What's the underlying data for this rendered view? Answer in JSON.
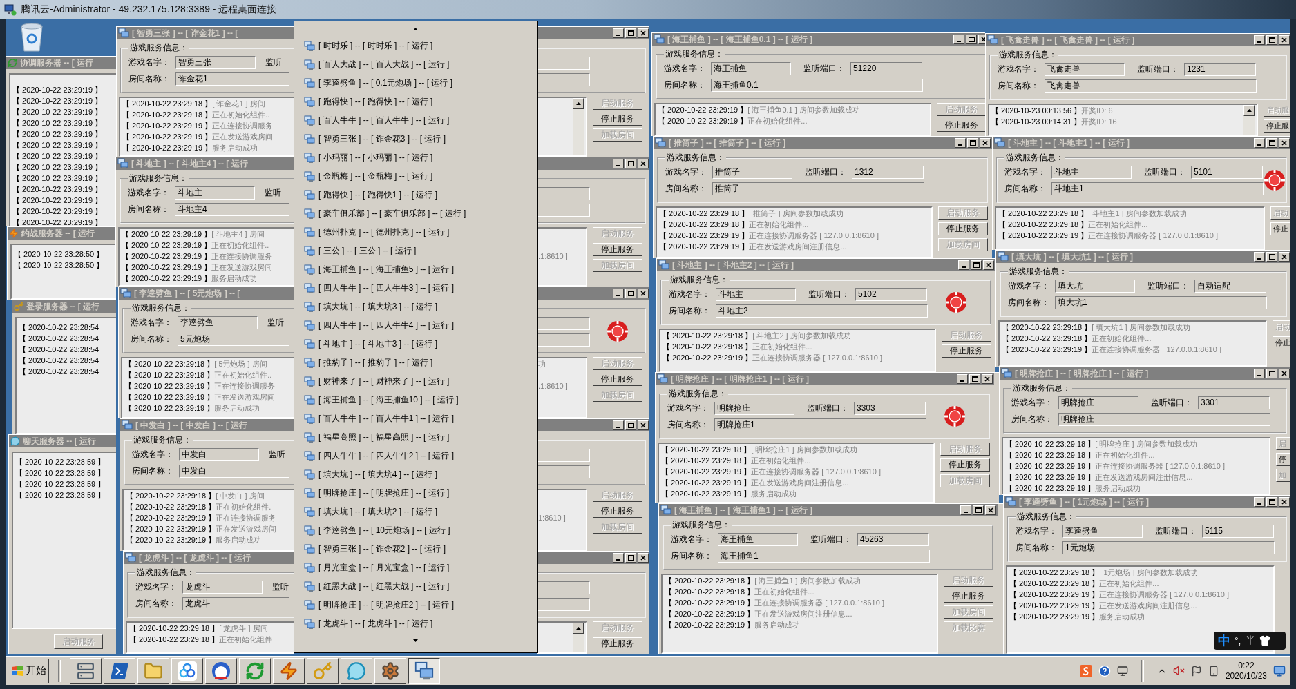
{
  "rdp_title": "腾讯云-Administrator - 49.232.175.128:3389 - 远程桌面连接",
  "service_windows": [
    {
      "title": "协调服务器 -- [ 运行",
      "logs": [
        "【 2020-10-22 23:29:19 】",
        "【 2020-10-22 23:29:19 】",
        "【 2020-10-22 23:29:19 】",
        "【 2020-10-22 23:29:19 】",
        "【 2020-10-22 23:29:19 】",
        "【 2020-10-22 23:29:19 】",
        "【 2020-10-22 23:29:19 】",
        "【 2020-10-22 23:29:19 】",
        "【 2020-10-22 23:29:19 】",
        "【 2020-10-22 23:29:19 】",
        "【 2020-10-22 23:29:19 】",
        "【 2020-10-22 23:29:19 】",
        "【 2020-10-22 23:29:19 】"
      ]
    },
    {
      "title": "约战服务器 -- [ 运行",
      "logs": [
        "【 2020-10-22 23:28:50 】",
        "【 2020-10-22 23:28:50 】"
      ]
    },
    {
      "title": "登录服务器 -- [ 运行",
      "logs": [
        "【 2020-10-22 23:28:54",
        "【 2020-10-22 23:28:54",
        "【 2020-10-22 23:28:54",
        "【 2020-10-22 23:28:54",
        "【 2020-10-22 23:28:54"
      ]
    },
    {
      "title": "聊天服务器 -- [ 运行",
      "logs": [
        "【 2020-10-22 23:28:59 】",
        "【 2020-10-22 23:28:59 】",
        "【 2020-10-22 23:28:59 】",
        "【 2020-10-22 23:28:59 】"
      ],
      "buttons": [
        {
          "label": "启动服务",
          "disabled": true
        }
      ]
    }
  ],
  "game_windows": [
    {
      "title": "[ 智勇三张 ] -- [ 诈金花1 ] -- [",
      "group_label": "游戏服务信息：",
      "name_label": "游戏名字：",
      "name": "智勇三张",
      "port_label": "监听",
      "room_label": "房间名称：",
      "room": "诈金花1",
      "logs": [
        {
          "time": "【 2020-10-22 23:29:18 】",
          "text": "[ 诈金花1 ] 房间"
        },
        {
          "time": "【 2020-10-22 23:29:18 】",
          "text": "正在初始化组件.."
        },
        {
          "time": "【 2020-10-22 23:29:19 】",
          "text": "正在连接协调服务"
        },
        {
          "time": "【 2020-10-22 23:29:19 】",
          "text": "正在发送游戏房间"
        },
        {
          "time": "【 2020-10-22 23:29:19 】",
          "text": "服务启动成功"
        }
      ],
      "buttons": [
        {
          "label": "启动服务",
          "disabled": true
        },
        {
          "label": "停止服务",
          "disabled": false
        },
        {
          "label": "加载房间",
          "disabled": true
        }
      ]
    },
    {
      "title": "[ 斗地主 ] -- [ 斗地主4 ] -- [ 运行",
      "group_label": "游戏服务信息：",
      "name_label": "游戏名字：",
      "name": "斗地主",
      "port_label": "监听",
      "room_label": "房间名称：",
      "room": "斗地主4",
      "logs": [
        {
          "time": "【 2020-10-22 23:29:19 】",
          "text": "[ 斗地主4 ] 房间"
        },
        {
          "time": "【 2020-10-22 23:29:19 】",
          "text": "正在初始化组件.."
        },
        {
          "time": "【 2020-10-22 23:29:19 】",
          "text": "正在连接协调服务",
          "tail": ".1:8610 ]"
        },
        {
          "time": "【 2020-10-22 23:29:19 】",
          "text": "正在发送游戏房间"
        },
        {
          "time": "【 2020-10-22 23:29:19 】",
          "text": "服务启动成功"
        }
      ],
      "buttons": [
        {
          "label": "启动服务",
          "disabled": true
        },
        {
          "label": "停止服务",
          "disabled": false
        },
        {
          "label": "加载房间",
          "disabled": true
        }
      ]
    },
    {
      "title": "[ 李逵劈鱼 ] -- [ 5元炮场 ] -- [",
      "group_label": "游戏服务信息：",
      "name_label": "游戏名字：",
      "name": "李逵劈鱼",
      "port_label": "监听",
      "room_label": "房间名称：",
      "room": "5元炮场",
      "chip": true,
      "logs": [
        {
          "time": "【 2020-10-22 23:29:18 】",
          "text": "[ 5元炮场 ] 房间",
          "tail": "功"
        },
        {
          "time": "【 2020-10-22 23:29:18 】",
          "text": "正在初始化组件.."
        },
        {
          "time": "【 2020-10-22 23:29:19 】",
          "text": "正在连接协调服务",
          "tail": ".1:8610 ]"
        },
        {
          "time": "【 2020-10-22 23:29:19 】",
          "text": "正在发送游戏房间"
        },
        {
          "time": "【 2020-10-22 23:29:19 】",
          "text": "服务启动成功"
        }
      ],
      "buttons": [
        {
          "label": "启动服务",
          "disabled": true
        },
        {
          "label": "停止服务",
          "disabled": false
        },
        {
          "label": "加载房间",
          "disabled": true
        }
      ]
    },
    {
      "title": "[ 中发白 ] -- [ 中发白 ] -- [ 运行",
      "group_label": "游戏服务信息：",
      "name_label": "游戏名字：",
      "name": "中发白",
      "port_label": "监听",
      "room_label": "房间名称：",
      "room": "中发白",
      "logs": [
        {
          "time": "【 2020-10-22 23:29:18 】",
          "text": "[ 中发白 ] 房间"
        },
        {
          "time": "【 2020-10-22 23:29:18 】",
          "text": "正在初始化组件."
        },
        {
          "time": "【 2020-10-22 23:29:19 】",
          "text": "正在连接协调服务",
          "tail": "1:8610 ]"
        },
        {
          "time": "【 2020-10-22 23:29:19 】",
          "text": "正在发送游戏房间"
        },
        {
          "time": "【 2020-10-22 23:29:19 】",
          "text": "服务启动成功"
        }
      ],
      "buttons": [
        {
          "label": "启动服务",
          "disabled": true
        },
        {
          "label": "停止服务",
          "disabled": false
        },
        {
          "label": "加载房间",
          "disabled": true
        }
      ]
    },
    {
      "title": "[ 龙虎斗 ] -- [ 龙虎斗 ] -- [ 运行",
      "group_label": "游戏服务信息：",
      "name_label": "游戏名字：",
      "name": "龙虎斗",
      "port_label": "监听",
      "room_label": "房间名称：",
      "room": "龙虎斗",
      "logs": [
        {
          "time": "【 2020-10-22 23:29:18 】",
          "text": "[ 龙虎斗 ] 房间"
        },
        {
          "time": "【 2020-10-22 23:29:18 】",
          "text": "正在初始化组件"
        }
      ],
      "buttons": [
        {
          "label": "启动服务",
          "disabled": true
        },
        {
          "label": "停止服务",
          "disabled": false
        }
      ]
    },
    {
      "title": "[ 海王捕鱼 ] -- [ 海王捕鱼0.1 ] -- [ 运行 ]",
      "group_label": "游戏服务信息：",
      "name_label": "游戏名字：",
      "name": "海王捕鱼",
      "port_label": "监听端口：",
      "port": "51220",
      "room_label": "房间名称：",
      "room": "海王捕鱼0.1",
      "logs": [
        {
          "time": "【 2020-10-22 23:29:19 】",
          "text": "[ 海王捕鱼0.1 ] 房间参数加载成功"
        },
        {
          "time": "【 2020-10-22 23:29:19 】",
          "text": "正在初始化组件..."
        }
      ],
      "buttons": [
        {
          "label": "启动服务",
          "disabled": true
        },
        {
          "label": "停止服务",
          "disabled": false
        }
      ]
    },
    {
      "title": "[ 推筒子 ] -- [ 推筒子 ] -- [ 运行 ]",
      "group_label": "游戏服务信息：",
      "name_label": "游戏名字：",
      "name": "推筒子",
      "port_label": "监听端口：",
      "port": "1312",
      "room_label": "房间名称：",
      "room": "推筒子",
      "logs": [
        {
          "time": "【 2020-10-22 23:29:18 】",
          "text": "[ 推筒子 ] 房间参数加载成功"
        },
        {
          "time": "【 2020-10-22 23:29:18 】",
          "text": "正在初始化组件..."
        },
        {
          "time": "【 2020-10-22 23:29:19 】",
          "text": "正在连接协调服务器 [ 127.0.0.1:8610 ]"
        },
        {
          "time": "【 2020-10-22 23:29:19 】",
          "text": "正在发送游戏房间注册信息..."
        }
      ],
      "buttons": [
        {
          "label": "启动服务",
          "disabled": true
        },
        {
          "label": "停止服务",
          "disabled": false
        },
        {
          "label": "加载房间",
          "disabled": true
        }
      ]
    },
    {
      "title": "[ 斗地主 ] -- [ 斗地主2 ] -- [ 运行 ]",
      "group_label": "游戏服务信息：",
      "name_label": "游戏名字：",
      "name": "斗地主",
      "port_label": "监听端口：",
      "port": "5102",
      "room_label": "房间名称：",
      "room": "斗地主2",
      "chip": true,
      "logs": [
        {
          "time": "【 2020-10-22 23:29:18 】",
          "text": "[ 斗地主2 ] 房间参数加载成功"
        },
        {
          "time": "【 2020-10-22 23:29:18 】",
          "text": "正在初始化组件..."
        },
        {
          "time": "【 2020-10-22 23:29:19 】",
          "text": "正在连接协调服务器 [ 127.0.0.1:8610 ]"
        }
      ],
      "buttons": [
        {
          "label": "启动服务",
          "disabled": true
        },
        {
          "label": "停止服务",
          "disabled": false
        }
      ]
    },
    {
      "title": "[ 明牌抢庄 ] -- [ 明牌抢庄1 ] -- [ 运行 ]",
      "group_label": "游戏服务信息：",
      "name_label": "游戏名字：",
      "name": "明牌抢庄",
      "port_label": "监听端口：",
      "port": "3303",
      "room_label": "房间名称：",
      "room": "明牌抢庄1",
      "chip": true,
      "logs": [
        {
          "time": "【 2020-10-22 23:29:18 】",
          "text": "[ 明牌抢庄1 ] 房间参数加载成功"
        },
        {
          "time": "【 2020-10-22 23:29:18 】",
          "text": "正在初始化组件..."
        },
        {
          "time": "【 2020-10-22 23:29:19 】",
          "text": "正在连接协调服务器 [ 127.0.0.1:8610 ]"
        },
        {
          "time": "【 2020-10-22 23:29:19 】",
          "text": "正在发送游戏房间注册信息..."
        },
        {
          "time": "【 2020-10-22 23:29:19 】",
          "text": "服务启动成功"
        }
      ],
      "buttons": [
        {
          "label": "启动服务",
          "disabled": true
        },
        {
          "label": "停止服务",
          "disabled": false
        },
        {
          "label": "加载房间",
          "disabled": true
        }
      ]
    },
    {
      "title": "[ 海王捕鱼 ] -- [ 海王捕鱼1 ] -- [ 运行 ]",
      "group_label": "游戏服务信息：",
      "name_label": "游戏名字：",
      "name": "海王捕鱼",
      "port_label": "监听端口：",
      "port": "45263",
      "room_label": "房间名称：",
      "room": "海王捕鱼1",
      "logs": [
        {
          "time": "【 2020-10-22 23:29:18 】",
          "text": "[ 海王捕鱼1 ] 房间参数加载成功"
        },
        {
          "time": "【 2020-10-22 23:29:18 】",
          "text": "正在初始化组件..."
        },
        {
          "time": "【 2020-10-22 23:29:19 】",
          "text": "正在连接协调服务器 [ 127.0.0.1:8610 ]"
        },
        {
          "time": "【 2020-10-22 23:29:19 】",
          "text": "正在发送游戏房间注册信息..."
        },
        {
          "time": "【 2020-10-22 23:29:19 】",
          "text": "服务启动成功"
        }
      ],
      "buttons": [
        {
          "label": "启动服务",
          "disabled": true
        },
        {
          "label": "停止服务",
          "disabled": false
        },
        {
          "label": "加载房间",
          "disabled": true
        },
        {
          "label": "加载比赛",
          "disabled": true
        }
      ]
    },
    {
      "title": "[ 飞禽走兽 ] -- [ 飞禽走兽 ] -- [ 运行 ]",
      "group_label": "游戏服务信息：",
      "name_label": "游戏名字：",
      "name": "飞禽走兽",
      "port_label": "监听端口：",
      "port": "1231",
      "room_label": "房间名称：",
      "room": "飞禽走兽",
      "logs": [
        {
          "time": "【 2020-10-23 00:13:56 】",
          "text": "开奖ID: 6"
        },
        {
          "time": "【 2020-10-23 00:14:31 】",
          "text": "开奖ID: 16"
        }
      ],
      "buttons": [
        {
          "label": "启动服",
          "disabled": true
        },
        {
          "label": "停止服",
          "disabled": false
        }
      ]
    },
    {
      "title": "[ 斗地主 ] -- [ 斗地主1 ] -- [ 运行 ]",
      "group_label": "游戏服务信息：",
      "name_label": "游戏名字：",
      "name": "斗地主",
      "port_label": "监听端口：",
      "port": "5101",
      "room_label": "房间名称：",
      "room": "斗地主1",
      "chip": true,
      "logs": [
        {
          "time": "【 2020-10-22 23:29:18 】",
          "text": "[ 斗地主1 ] 房间参数加载成功"
        },
        {
          "time": "【 2020-10-22 23:29:18 】",
          "text": "正在初始化组件..."
        },
        {
          "time": "【 2020-10-22 23:29:19 】",
          "text": "正在连接协调服务器 [ 127.0.0.1:8610 ]"
        }
      ],
      "buttons": [
        {
          "label": "启动",
          "disabled": true
        },
        {
          "label": "停止",
          "disabled": false
        }
      ]
    },
    {
      "title": "[ 填大坑 ] -- [ 填大坑1 ] -- [ 运行 ]",
      "group_label": "游戏服务信息：",
      "name_label": "游戏名字：",
      "name": "填大坑",
      "port_label": "监听端口：",
      "port": "自动适配",
      "room_label": "房间名称：",
      "room": "填大坑1",
      "logs": [
        {
          "time": "【 2020-10-22 23:29:18 】",
          "text": "[ 填大坑1 ] 房间参数加载成功"
        },
        {
          "time": "【 2020-10-22 23:29:18 】",
          "text": "正在初始化组件..."
        },
        {
          "time": "【 2020-10-22 23:29:19 】",
          "text": "正在连接协调服务器 [ 127.0.0.1:8610 ]"
        }
      ],
      "buttons": [
        {
          "label": "启动",
          "disabled": true
        },
        {
          "label": "停止",
          "disabled": false
        }
      ]
    },
    {
      "title": "[ 明牌抢庄 ] -- [ 明牌抢庄 ] -- [ 运行 ]",
      "group_label": "游戏服务信息：",
      "name_label": "游戏名字：",
      "name": "明牌抢庄",
      "port_label": "监听端口：",
      "port": "3301",
      "room_label": "房间名称：",
      "room": "明牌抢庄",
      "logs": [
        {
          "time": "【 2020-10-22 23:29:18 】",
          "text": "[ 明牌抢庄 ] 房间参数加载成功"
        },
        {
          "time": "【 2020-10-22 23:29:18 】",
          "text": "正在初始化组件..."
        },
        {
          "time": "【 2020-10-22 23:29:19 】",
          "text": "正在连接协调服务器 [ 127.0.0.1:8610 ]"
        },
        {
          "time": "【 2020-10-22 23:29:19 】",
          "text": "正在发送游戏房间注册信息..."
        },
        {
          "time": "【 2020-10-22 23:29:19 】",
          "text": "服务启动成功"
        }
      ],
      "buttons": [
        {
          "label": "启",
          "disabled": true
        },
        {
          "label": "停",
          "disabled": false
        },
        {
          "label": "加",
          "disabled": true
        }
      ]
    },
    {
      "title": "[ 李逵劈鱼 ] -- [ 1元炮场 ] -- [ 运行 ]",
      "group_label": "游戏服务信息：",
      "name_label": "游戏名字：",
      "name": "李逵劈鱼",
      "port_label": "监听端口：",
      "port": "5115",
      "room_label": "房间名称：",
      "room": "1元炮场",
      "logs": [
        {
          "time": "【 2020-10-22 23:29:18 】",
          "text": "[ 1元炮场 ] 房间参数加载成功"
        },
        {
          "time": "【 2020-10-22 23:29:18 】",
          "text": "正在初始化组件..."
        },
        {
          "time": "【 2020-10-22 23:29:19 】",
          "text": "正在连接协调服务器 [ 127.0.0.1:8610 ]"
        },
        {
          "time": "【 2020-10-22 23:29:19 】",
          "text": "正在发送游戏房间注册信息..."
        },
        {
          "time": "【 2020-10-22 23:29:19 】",
          "text": "服务启动成功"
        }
      ]
    }
  ],
  "window_menu": [
    "[ 时时乐 ] -- [ 时时乐 ] -- [ 运行 ]",
    "[ 百人大战 ] -- [ 百人大战 ] -- [ 运行 ]",
    "[ 李逵劈鱼 ] -- [ 0.1元炮场 ] -- [ 运行 ]",
    "[ 跑得快 ] -- [ 跑得快 ] -- [ 运行 ]",
    "[ 百人牛牛 ] -- [ 百人牛牛 ] -- [ 运行 ]",
    "[ 智勇三张 ] -- [ 诈金花3 ] -- [ 运行 ]",
    "[ 小玛丽 ] -- [ 小玛丽 ] -- [ 运行 ]",
    "[ 金瓶梅 ] -- [ 金瓶梅 ] -- [ 运行 ]",
    "[ 跑得快 ] -- [ 跑得快1 ] -- [ 运行 ]",
    "[ 豪车俱乐部 ] -- [ 豪车俱乐部 ] -- [ 运行 ]",
    "[ 德州扑克 ] -- [ 德州扑克 ] -- [ 运行 ]",
    "[ 三公 ] -- [ 三公 ] -- [ 运行 ]",
    "[ 海王捕鱼 ] -- [ 海王捕鱼5 ] -- [ 运行 ]",
    "[ 四人牛牛 ] -- [ 四人牛牛3 ] -- [ 运行 ]",
    "[ 填大坑 ] -- [ 填大坑3 ] -- [ 运行 ]",
    "[ 四人牛牛 ] -- [ 四人牛牛4 ] -- [ 运行 ]",
    "[ 斗地主 ] -- [ 斗地主3 ] -- [ 运行 ]",
    "[ 推豹子 ] -- [ 推豹子 ] -- [ 运行 ]",
    "[ 财神来了 ] -- [ 财神来了 ] -- [ 运行 ]",
    "[ 海王捕鱼 ] -- [ 海王捕鱼10 ] -- [ 运行 ]",
    "[ 百人牛牛 ] -- [ 百人牛牛1 ] -- [ 运行 ]",
    "[ 福星高照 ] -- [ 福星高照 ] -- [ 运行 ]",
    "[ 四人牛牛 ] -- [ 四人牛牛2 ] -- [ 运行 ]",
    "[ 填大坑 ] -- [ 填大坑4 ] -- [ 运行 ]",
    "[ 明牌抢庄 ] -- [ 明牌抢庄 ] -- [ 运行 ]",
    "[ 填大坑 ] -- [ 填大坑2 ] -- [ 运行 ]",
    "[ 李逵劈鱼 ] -- [ 10元炮场 ] -- [ 运行 ]",
    "[ 智勇三张 ] -- [ 诈金花2 ] -- [ 运行 ]",
    "[ 月光宝盒 ] -- [ 月光宝盒 ] -- [ 运行 ]",
    "[ 红黑大战 ] -- [ 红黑大战 ] -- [ 运行 ]",
    "[ 明牌抢庄 ] -- [ 明牌抢庄2 ] -- [ 运行 ]",
    "[ 龙虎斗 ] -- [ 龙虎斗 ] -- [ 运行 ]"
  ],
  "ime": {
    "mode": "中",
    "punct": "°,",
    "width": "半"
  },
  "taskbar": {
    "start": "开始",
    "buttons": [
      {
        "selected": false
      },
      {
        "selected": false
      },
      {
        "selected": false
      },
      {
        "selected": false
      },
      {
        "selected": false
      },
      {
        "selected": false
      },
      {
        "selected": false
      },
      {
        "selected": false
      },
      {
        "selected": false
      },
      {
        "selected": false
      },
      {
        "selected": true
      }
    ],
    "time": "0:22",
    "date": "2020/10/23"
  }
}
